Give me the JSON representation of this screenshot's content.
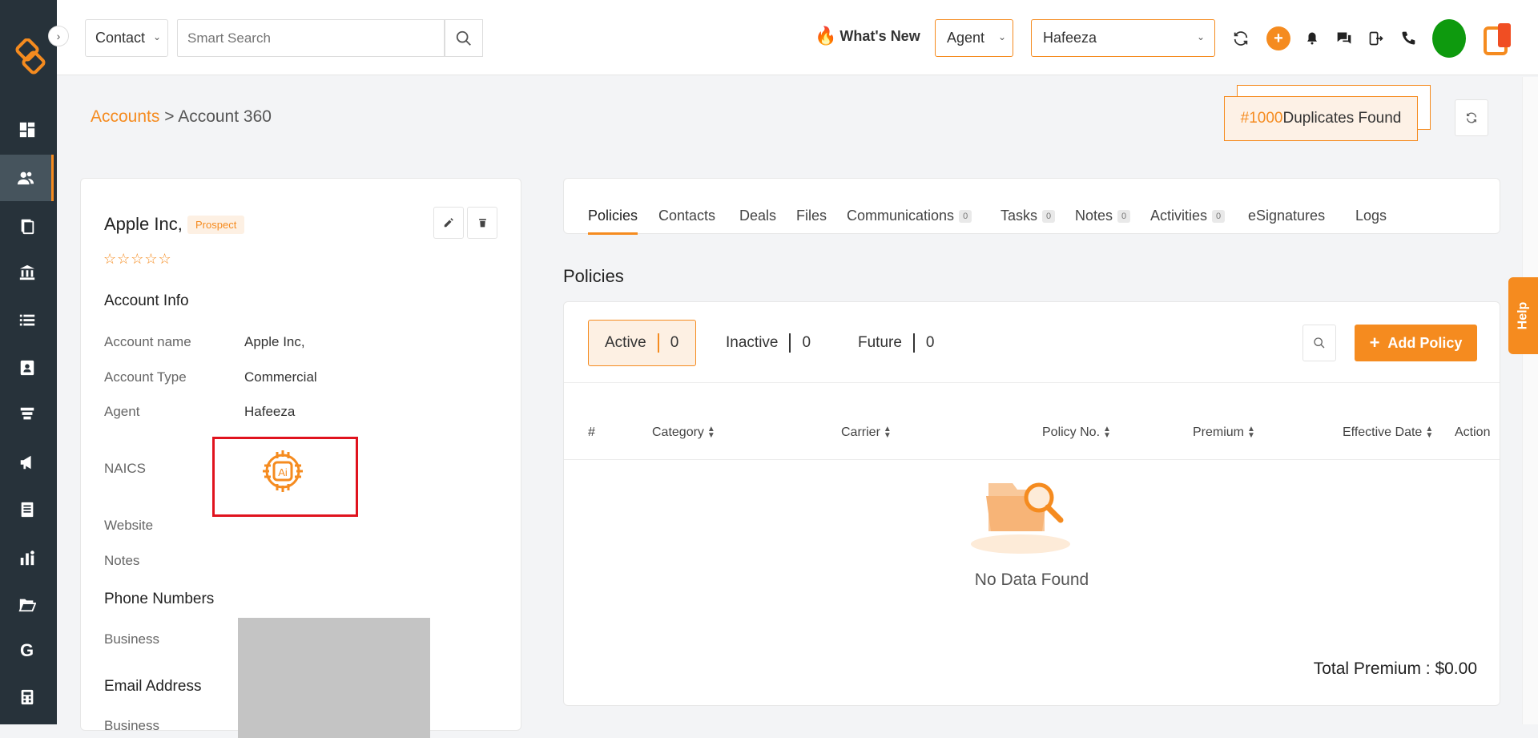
{
  "header": {
    "contact_select": "Contact",
    "search_placeholder": "Smart Search",
    "whats_new": "What's New",
    "agent_select": "Agent",
    "user_select": "Hafeeza"
  },
  "breadcrumb": {
    "root": "Accounts",
    "separator": ">",
    "current": "Account 360"
  },
  "duplicates": {
    "count": "#1000",
    "label": "Duplicates Found"
  },
  "account": {
    "name": "Apple Inc,",
    "badge": "Prospect",
    "stars": "☆☆☆☆☆",
    "account_info_title": "Account Info",
    "fields": {
      "account_name_label": "Account name",
      "account_name_value": "Apple Inc,",
      "account_type_label": "Account Type",
      "account_type_value": "Commercial",
      "agent_label": "Agent",
      "agent_value": "Hafeeza",
      "naics_label": "NAICS",
      "website_label": "Website",
      "notes_label": "Notes"
    },
    "phone_title": "Phone Numbers",
    "phone_business_label": "Business",
    "email_title": "Email Address",
    "email_business_label": "Business"
  },
  "tabs": [
    {
      "label": "Policies"
    },
    {
      "label": "Contacts"
    },
    {
      "label": "Deals"
    },
    {
      "label": "Files"
    },
    {
      "label": "Communications",
      "count": "0"
    },
    {
      "label": "Tasks",
      "count": "0"
    },
    {
      "label": "Notes",
      "count": "0"
    },
    {
      "label": "Activities",
      "count": "0"
    },
    {
      "label": "eSignatures"
    },
    {
      "label": "Logs"
    }
  ],
  "policies": {
    "title": "Policies",
    "filters": [
      {
        "label": "Active",
        "count": "0"
      },
      {
        "label": "Inactive",
        "count": "0"
      },
      {
        "label": "Future",
        "count": "0"
      }
    ],
    "add_button": "Add Policy",
    "columns": [
      "#",
      "Category",
      "Carrier",
      "Policy No.",
      "Premium",
      "Effective Date",
      "Action"
    ],
    "empty_text": "No Data Found",
    "total": "Total Premium : $0.00"
  },
  "help": "Help",
  "colors": {
    "accent": "#f58b1f",
    "sidebar": "#27323a",
    "highlight_box": "#e0131e"
  }
}
